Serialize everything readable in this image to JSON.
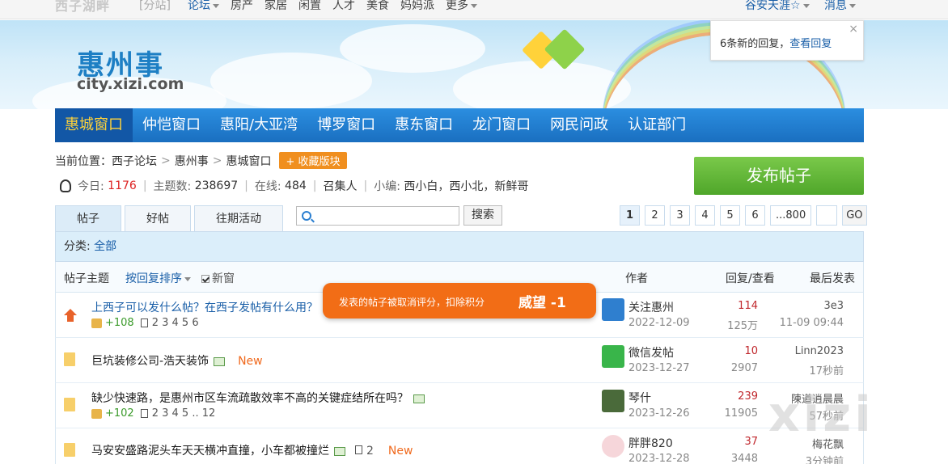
{
  "topbar": {
    "brand": "西子湖畔",
    "branch": "[分站]",
    "nav": [
      "论坛",
      "房产",
      "家居",
      "闲置",
      "人才",
      "美食",
      "妈妈派",
      "更多"
    ],
    "user": "谷安天涯☆",
    "messages": "消息"
  },
  "header": {
    "logo_cn": "惠州事",
    "logo_en": "city.xizi.com"
  },
  "notice": {
    "text": "6条新的回复，",
    "link": "查看回复",
    "close": "×"
  },
  "mainnav": [
    "惠城窗口",
    "仲恺窗口",
    "惠阳/大亚湾",
    "博罗窗口",
    "惠东窗口",
    "龙门窗口",
    "网民问政",
    "认证部门"
  ],
  "crumb": {
    "prefix": "当前位置：",
    "items": [
      "西子论坛",
      "惠州事",
      "惠城窗口"
    ],
    "sep": ">",
    "fav": "+ 收藏版块"
  },
  "stats": {
    "today_label": "今日:",
    "today": "1176",
    "topics_label": "主题数:",
    "topics": "238697",
    "online_label": "在线:",
    "online": "484",
    "convener": "召集人",
    "editors_label": "小编:",
    "editors": "西小白，西小北，新鲜哥"
  },
  "post_button": "发布帖子",
  "tabs": [
    "帖子",
    "好帖",
    "往期活动"
  ],
  "search": {
    "placeholder": "",
    "button": "搜索"
  },
  "pager": {
    "pages": [
      "1",
      "2",
      "3",
      "4",
      "5",
      "6",
      "...800"
    ],
    "go": "GO"
  },
  "category": {
    "label": "分类:",
    "all": "全部"
  },
  "thead": {
    "topic": "帖子主题",
    "sort": "按回复排序",
    "newest": "新窗",
    "author": "作者",
    "replies": "回复/查看",
    "last": "最后发表"
  },
  "rows": [
    {
      "title": "上西子可以发什么帖？在西子发帖有什么用？",
      "likes": "+108",
      "pages": "2 3 4 5 6",
      "author": "关注惠州",
      "date": "2022-12-09",
      "replies": "114",
      "views": "125万",
      "last": "3e3",
      "last_time": "11-09 09:44"
    },
    {
      "title": "巨坑装修公司-浩天装饰",
      "new": "New",
      "author": "微信发帖",
      "date": "2023-12-27",
      "replies": "10",
      "views": "2907",
      "last": "Linn2023",
      "last_time": "17秒前"
    },
    {
      "title": "缺少快速路，是惠州市区车流疏散效率不高的关键症结所在吗？",
      "likes": "+102",
      "pages": "2 3 4 5 .. 12",
      "author": "琴什",
      "date": "2023-12-26",
      "replies": "239",
      "views": "11905",
      "last": "陳遒逍晨晨",
      "last_time": "57秒前"
    },
    {
      "title": "马安安盛路泥头车天天横冲直撞，小车都被撞烂",
      "pagecount": "2",
      "new": "New",
      "author": "胖胖820",
      "date": "2023-12-28",
      "replies": "37",
      "views": "3448",
      "last": "梅花飘",
      "last_time": "3分钟前"
    }
  ],
  "toast": {
    "message": "发表的帖子被取消评分，扣除积分",
    "value": "威望 -1"
  },
  "watermark": "xizi"
}
